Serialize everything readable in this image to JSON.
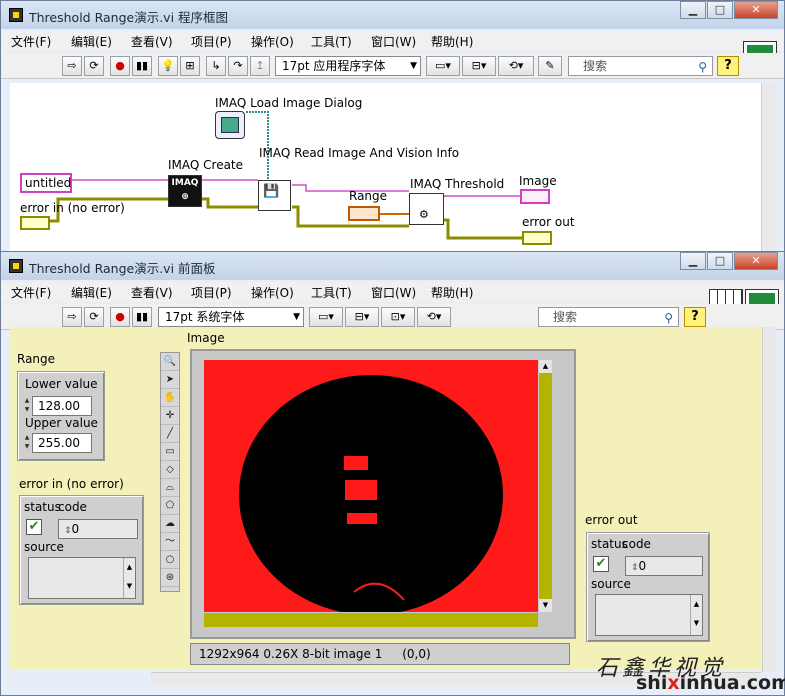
{
  "diagram_window": {
    "title": "Threshold Range演示.vi 程序框图",
    "menu": [
      "文件(F)",
      "编辑(E)",
      "查看(V)",
      "项目(P)",
      "操作(O)",
      "工具(T)",
      "窗口(W)",
      "帮助(H)"
    ],
    "font_select": "17pt 应用程序字体",
    "search_placeholder": "搜索",
    "icon_badge": "5",
    "labels": {
      "load_dialog": "IMAQ Load Image Dialog",
      "read_info": "IMAQ Read Image And Vision Info",
      "create": "IMAQ Create",
      "range": "Range",
      "threshold": "IMAQ Threshold",
      "image": "Image",
      "error_in": "error in (no error)",
      "error_out": "error out",
      "untitled": "untitled"
    }
  },
  "panel_window": {
    "title": "Threshold Range演示.vi 前面板",
    "menu": [
      "文件(F)",
      "编辑(E)",
      "查看(V)",
      "项目(P)",
      "操作(O)",
      "工具(T)",
      "窗口(W)",
      "帮助(H)"
    ],
    "font_select": "17pt 系统字体",
    "search_placeholder": "搜索",
    "icon_badge": "5",
    "range": {
      "label": "Range",
      "lower_label": "Lower value",
      "lower_value": "128.00",
      "upper_label": "Upper value",
      "upper_value": "255.00"
    },
    "error_in": {
      "label": "error in (no error)",
      "status_label": "status",
      "code_label": "code",
      "code_value": "0",
      "source_label": "source"
    },
    "error_out": {
      "label": "error out",
      "status_label": "status",
      "code_label": "code",
      "code_value": "0",
      "source_label": "source"
    },
    "image": {
      "label": "Image",
      "status_text": "1292x964 0.26X 8-bit image 1",
      "coords": "(0,0)"
    }
  },
  "watermark": {
    "chinese": "石鑫华视觉",
    "url_prefix": "shi",
    "url_red": "x",
    "url_mid": "inhua",
    "url_suffix": ".com"
  },
  "colors": {
    "titlebar": "#c3d3e8",
    "fp_background": "#f3f1b9",
    "image_red": "#ff1a1a",
    "scroll_olive": "#b3b300",
    "wire_pink": "#d04ec8",
    "wire_teal": "#2e8c8c",
    "wire_olive": "#8c8c00",
    "wire_orange": "#d06a00"
  }
}
